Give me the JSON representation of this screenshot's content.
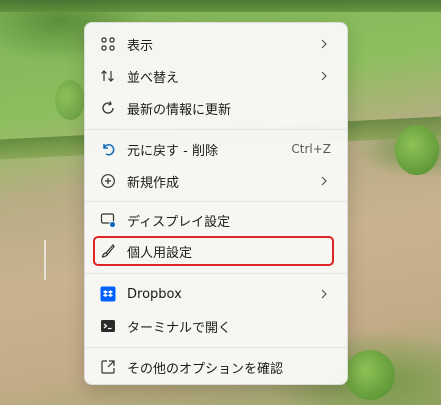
{
  "context_menu": {
    "items": [
      {
        "label": "表示",
        "icon": "view-grid-icon",
        "has_submenu": true
      },
      {
        "label": "並べ替え",
        "icon": "sort-icon",
        "has_submenu": true
      },
      {
        "label": "最新の情報に更新",
        "icon": "refresh-icon",
        "has_submenu": false
      },
      {
        "label": "元に戻す - 削除",
        "icon": "undo-icon",
        "shortcut": "Ctrl+Z"
      },
      {
        "label": "新規作成",
        "icon": "new-plus-icon",
        "has_submenu": true
      },
      {
        "label": "ディスプレイ設定",
        "icon": "display-settings-icon"
      },
      {
        "label": "個人用設定",
        "icon": "brush-icon",
        "highlighted": true
      },
      {
        "label": "Dropbox",
        "icon": "dropbox-icon",
        "has_submenu": true
      },
      {
        "label": "ターミナルで開く",
        "icon": "terminal-icon"
      },
      {
        "label": "その他のオプションを確認",
        "icon": "more-options-icon"
      }
    ]
  },
  "colors": {
    "highlight_border": "#e02424",
    "accent": "#0f6cbd",
    "dropbox_blue": "#0061fe"
  }
}
